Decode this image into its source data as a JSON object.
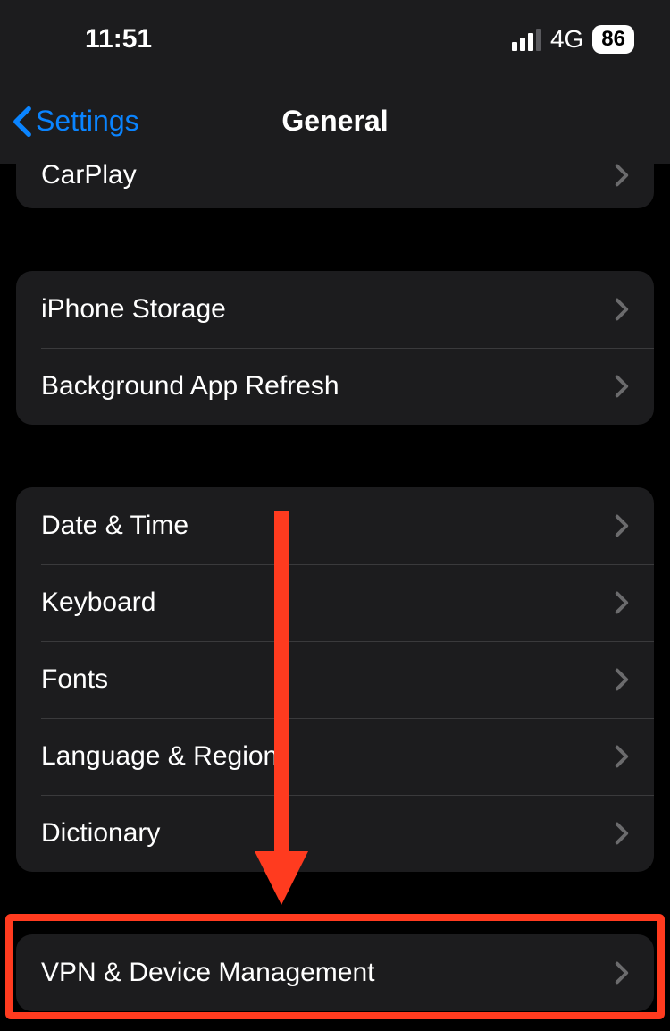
{
  "status": {
    "time": "11:51",
    "network": "4G",
    "battery": "86"
  },
  "nav": {
    "back": "Settings",
    "title": "General"
  },
  "groups": [
    {
      "rows": [
        {
          "label": "CarPlay"
        }
      ],
      "partial": true
    },
    {
      "rows": [
        {
          "label": "iPhone Storage"
        },
        {
          "label": "Background App Refresh"
        }
      ]
    },
    {
      "rows": [
        {
          "label": "Date & Time"
        },
        {
          "label": "Keyboard"
        },
        {
          "label": "Fonts"
        },
        {
          "label": "Language & Region"
        },
        {
          "label": "Dictionary"
        }
      ]
    },
    {
      "rows": [
        {
          "label": "VPN & Device Management"
        }
      ]
    }
  ],
  "annotation": {
    "highlight_color": "#ff3b1f"
  }
}
